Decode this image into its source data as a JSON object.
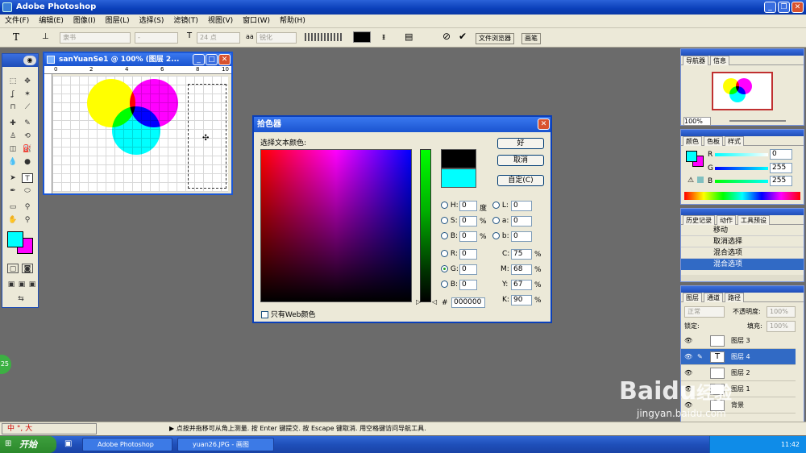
{
  "app": {
    "title": "Adobe Photoshop"
  },
  "menu": [
    "文件(F)",
    "编辑(E)",
    "图像(I)",
    "图层(L)",
    "选择(S)",
    "滤镜(T)",
    "视图(V)",
    "窗口(W)",
    "帮助(H)"
  ],
  "options": {
    "tool_label": "T",
    "font_family": "隶书",
    "font_style": "-",
    "font_size": "24 点",
    "aa_label": "aa",
    "antialias": "锐化",
    "file_browser": "文件浏览器",
    "brushes": "画笔"
  },
  "document": {
    "title": "sanYuanSe1 @ 100% (图层 2...",
    "ruler_marks": [
      "0",
      "2",
      "4",
      "6",
      "8",
      "10"
    ]
  },
  "picker": {
    "title": "拾色器",
    "prompt": "选择文本颜色:",
    "ok": "好",
    "cancel": "取消",
    "custom": "自定(C)",
    "web_only": "只有Web颜色",
    "hex_label": "#",
    "hex": "000000",
    "fields": {
      "H": {
        "label": "H:",
        "value": "0",
        "unit": "度"
      },
      "S": {
        "label": "S:",
        "value": "0",
        "unit": "%"
      },
      "Bv": {
        "label": "B:",
        "value": "0",
        "unit": "%"
      },
      "R": {
        "label": "R:",
        "value": "0"
      },
      "G": {
        "label": "G:",
        "value": "0"
      },
      "B": {
        "label": "B:",
        "value": "0"
      },
      "L": {
        "label": "L:",
        "value": "0"
      },
      "a": {
        "label": "a:",
        "value": "0"
      },
      "b": {
        "label": "b:",
        "value": "0"
      },
      "C": {
        "label": "C:",
        "value": "75",
        "unit": "%"
      },
      "M": {
        "label": "M:",
        "value": "68",
        "unit": "%"
      },
      "Y": {
        "label": "Y:",
        "value": "67",
        "unit": "%"
      },
      "K": {
        "label": "K:",
        "value": "90",
        "unit": "%"
      }
    }
  },
  "navigator": {
    "tabs": [
      "导航器",
      "信息"
    ],
    "zoom": "100%"
  },
  "color_panel": {
    "tabs": [
      "颜色",
      "色板",
      "样式"
    ],
    "R": "0",
    "G": "255",
    "B": "255",
    "r_label": "R",
    "g_label": "G",
    "b_label": "B"
  },
  "history": {
    "tabs": [
      "历史记录",
      "动作",
      "工具预设"
    ],
    "items": [
      "移动",
      "取消选择",
      "混合选项",
      "混合选项"
    ]
  },
  "layers": {
    "tabs": [
      "图层",
      "通道",
      "路径"
    ],
    "mode": "正常",
    "opacity_label": "不透明度:",
    "opacity": "100%",
    "lock_label": "锁定:",
    "fill_label": "填充:",
    "fill": "100%",
    "items": [
      {
        "name": "图层 3"
      },
      {
        "name": "图层 4"
      },
      {
        "name": "图层 2"
      },
      {
        "name": "图层 1"
      },
      {
        "name": "背景"
      }
    ]
  },
  "status": {
    "text": "▶ 点按并拖移可从角上测量. 按 Enter 键提交. 按 Escape 键取消. 用空格键访问导航工具."
  },
  "ime": {
    "text": "中 °, 大"
  },
  "taskbar": {
    "start": "开始",
    "tasks": [
      "Adobe Photoshop",
      "yuan26.JPG - 画图"
    ],
    "time": "11:42"
  },
  "badge": "25",
  "watermark": {
    "brand": "Baidu",
    "sub": "经验",
    "url": "jingyan.baidu.com"
  },
  "colors": {
    "fg": "#00ffff",
    "bg": "#ff00ff",
    "accent": "#316ac5"
  }
}
